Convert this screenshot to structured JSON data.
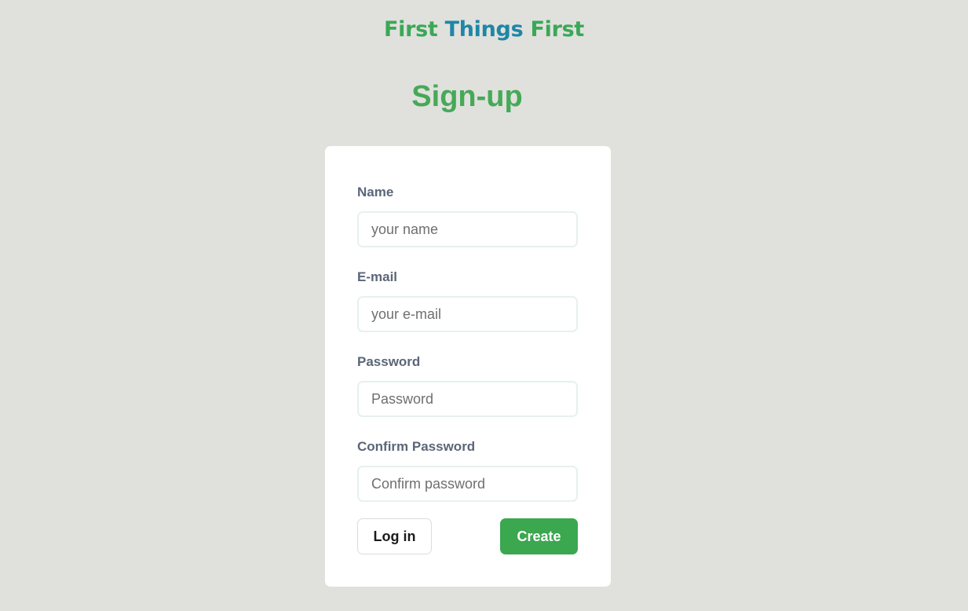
{
  "brand": {
    "word1": "First",
    "word2": "Things",
    "word3": "First"
  },
  "page_title": "Sign-up",
  "form": {
    "fields": [
      {
        "label": "Name",
        "placeholder": "your name",
        "value": ""
      },
      {
        "label": "E-mail",
        "placeholder": "your e-mail",
        "value": ""
      },
      {
        "label": "Password",
        "placeholder": "Password",
        "value": ""
      },
      {
        "label": "Confirm Password",
        "placeholder": "Confirm password",
        "value": ""
      }
    ],
    "login_label": "Log in",
    "create_label": "Create"
  },
  "colors": {
    "background": "#e0e1dd",
    "brand_green": "#3aa856",
    "brand_blue": "#1f86a6",
    "title_green": "#46a957",
    "create_button": "#3ba74f",
    "label_gray": "#5b6678"
  }
}
